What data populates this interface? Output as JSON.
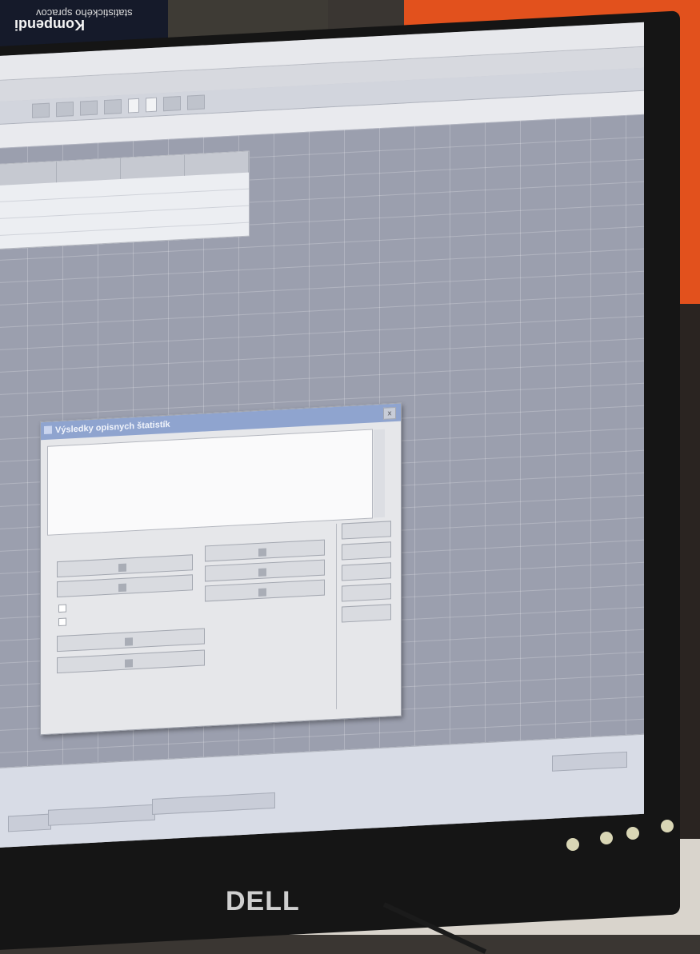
{
  "background": {
    "book_title": "Kompendi",
    "book_subtitle": "statistického spracov"
  },
  "monitor": {
    "brand": "DELL"
  },
  "app": {
    "menu": [
      "",
      "",
      "",
      "",
      "",
      ""
    ],
    "toolbar_fields": [
      "",
      ""
    ],
    "formula_text": ""
  },
  "table": {
    "headers": [
      "",
      "",
      "",
      ""
    ],
    "rows": [
      [
        "",
        "",
        "",
        ""
      ],
      [
        "",
        "",
        "",
        ""
      ],
      [
        "",
        "",
        "",
        ""
      ]
    ]
  },
  "dialog": {
    "title": "Výsledky opisnych štatistík",
    "close_glyph": "x",
    "preview_lines": [
      "",
      "",
      "",
      "",
      "",
      ""
    ],
    "status": "",
    "buttons_left": [
      "",
      "",
      "",
      ""
    ],
    "buttons_middle": [
      "",
      "",
      ""
    ],
    "checkboxes": [
      "",
      ""
    ],
    "buttons_right": [
      "",
      "",
      "",
      "",
      ""
    ]
  },
  "taskbar": {
    "items": [
      "",
      "",
      "",
      ""
    ]
  }
}
